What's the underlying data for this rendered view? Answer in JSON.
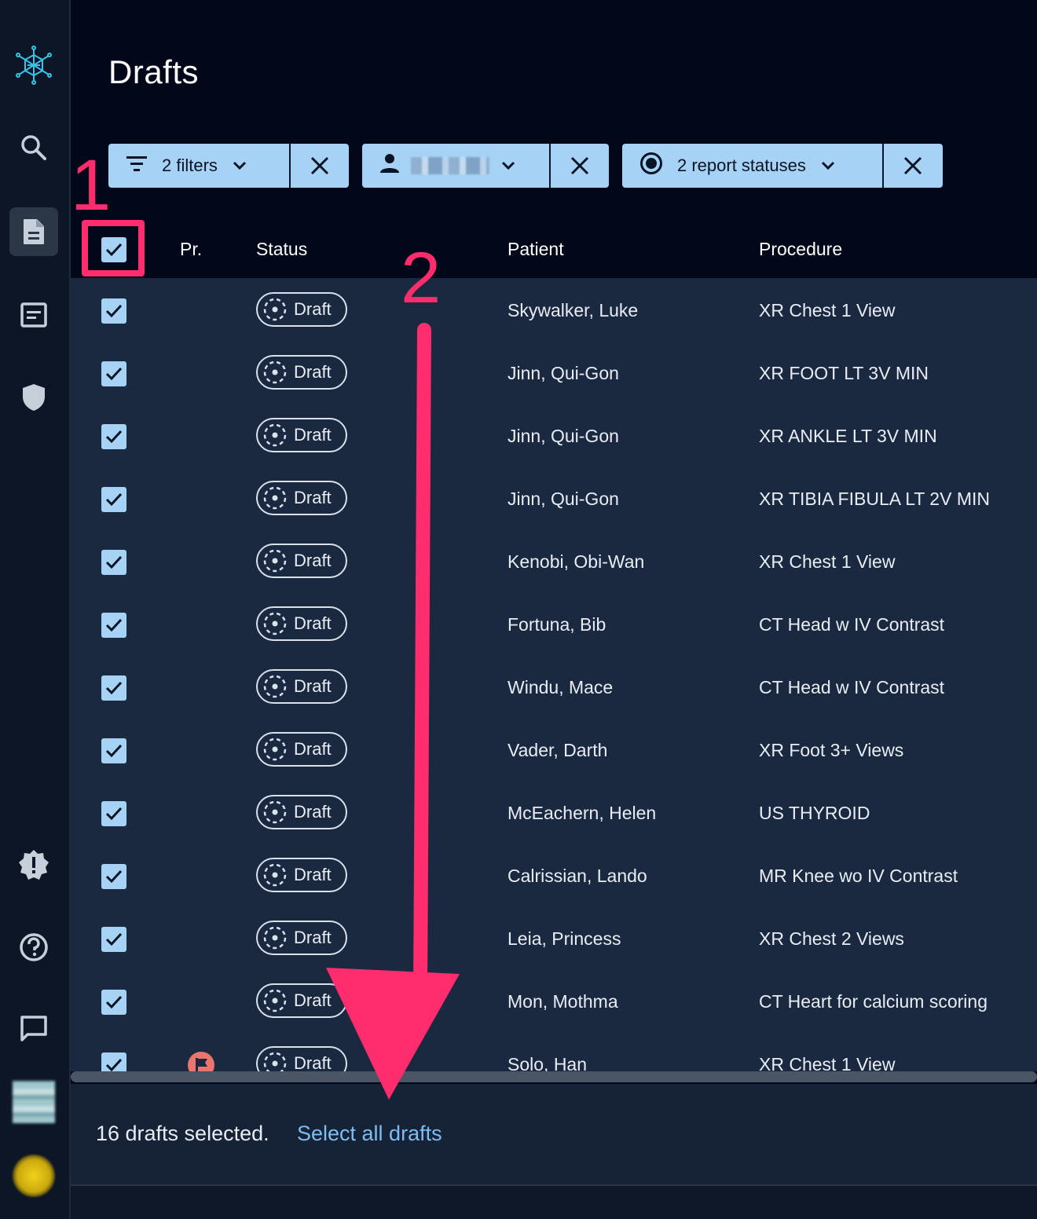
{
  "page": {
    "title": "Drafts"
  },
  "sidebar": {
    "items": [
      {
        "name": "logo-icon"
      },
      {
        "name": "search-icon"
      },
      {
        "name": "document-icon",
        "active": true
      },
      {
        "name": "template-icon"
      },
      {
        "name": "shield-icon"
      },
      {
        "name": "alert-badge-icon"
      },
      {
        "name": "help-icon"
      },
      {
        "name": "chat-icon"
      }
    ]
  },
  "filters": {
    "filter_chip_label": "2 filters",
    "user_chip_label": "",
    "status_chip_label": "2 report statuses"
  },
  "annotations": {
    "step1": "1",
    "step2": "2"
  },
  "table": {
    "headers": {
      "priority": "Pr.",
      "status": "Status",
      "patient": "Patient",
      "procedure": "Procedure"
    },
    "rows": [
      {
        "status": "Draft",
        "patient": "Skywalker, Luke",
        "procedure": "XR Chest 1 View",
        "checked": true
      },
      {
        "status": "Draft",
        "patient": "Jinn, Qui-Gon",
        "procedure": "XR FOOT LT 3V MIN",
        "checked": true
      },
      {
        "status": "Draft",
        "patient": "Jinn, Qui-Gon",
        "procedure": "XR ANKLE LT 3V MIN",
        "checked": true
      },
      {
        "status": "Draft",
        "patient": "Jinn, Qui-Gon",
        "procedure": "XR TIBIA FIBULA LT 2V MIN",
        "checked": true
      },
      {
        "status": "Draft",
        "patient": "Kenobi, Obi-Wan",
        "procedure": "XR Chest 1 View",
        "checked": true
      },
      {
        "status": "Draft",
        "patient": "Fortuna, Bib",
        "procedure": "CT Head w IV Contrast",
        "checked": true
      },
      {
        "status": "Draft",
        "patient": "Windu, Mace",
        "procedure": "CT Head w IV Contrast",
        "checked": true
      },
      {
        "status": "Draft",
        "patient": "Vader, Darth",
        "procedure": "XR Foot 3+ Views",
        "checked": true
      },
      {
        "status": "Draft",
        "patient": "McEachern, Helen",
        "procedure": "US THYROID",
        "checked": true
      },
      {
        "status": "Draft",
        "patient": "Calrissian, Lando",
        "procedure": "MR Knee wo IV Contrast",
        "checked": true
      },
      {
        "status": "Draft",
        "patient": "Leia, Princess",
        "procedure": "XR Chest 2 Views",
        "checked": true
      },
      {
        "status": "Draft",
        "patient": "Mon, Mothma",
        "procedure": "CT Heart for calcium scoring",
        "checked": true
      },
      {
        "status": "Draft",
        "patient": "Solo, Han",
        "procedure": "XR Chest 1 View",
        "checked": true,
        "priority_flag": true
      }
    ]
  },
  "footer": {
    "selected_text": "16 drafts selected.",
    "select_all_label": "Select all drafts"
  },
  "colors": {
    "accent": "#a6d3f5",
    "annotation": "#ff2d6d",
    "link": "#7fbcf0",
    "flag": "#e8766f"
  }
}
